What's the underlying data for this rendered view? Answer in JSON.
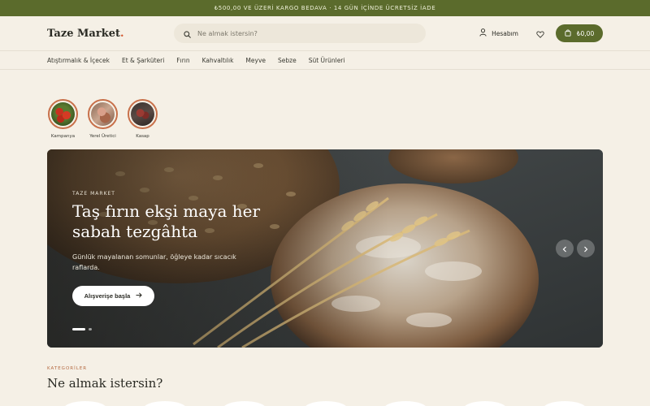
{
  "announcement": "₺500,00 VE ÜZERİ KARGO BEDAVA · 14 GÜN İÇİNDE ÜCRETSİZ İADE",
  "header": {
    "logo": "Taze Market",
    "logo_dot": ".",
    "search_placeholder": "Ne almak istersin?",
    "account_label": "Hesabım",
    "cart_total": "₺0,00"
  },
  "nav": {
    "items": [
      "Atıştırmalık & İçecek",
      "Et & Şarküteri",
      "Fırın",
      "Kahvaltılık",
      "Meyve",
      "Sebze",
      "Süt Ürünleri"
    ]
  },
  "stories": [
    {
      "label": "Kampanya",
      "icon": "tomatoes-thumb"
    },
    {
      "label": "Yerel Üretici",
      "icon": "producer-thumb"
    },
    {
      "label": "Kasap",
      "icon": "butcher-thumb"
    }
  ],
  "hero": {
    "eyebrow": "TAZE MARKET",
    "title": "Taş fırın ekşi maya her sabah tezgâhta",
    "subtitle": "Günlük mayalanan somunlar, öğleye kadar sıcacık raflarda.",
    "cta": "Alışverişe başla",
    "slide_count": 2,
    "active_slide": 1
  },
  "categories": {
    "eyebrow": "KATEGORİLER",
    "title": "Ne almak istersin?"
  },
  "colors": {
    "brand": "#5b6b2c",
    "accent": "#d2552d",
    "background": "#f5f0e6"
  }
}
